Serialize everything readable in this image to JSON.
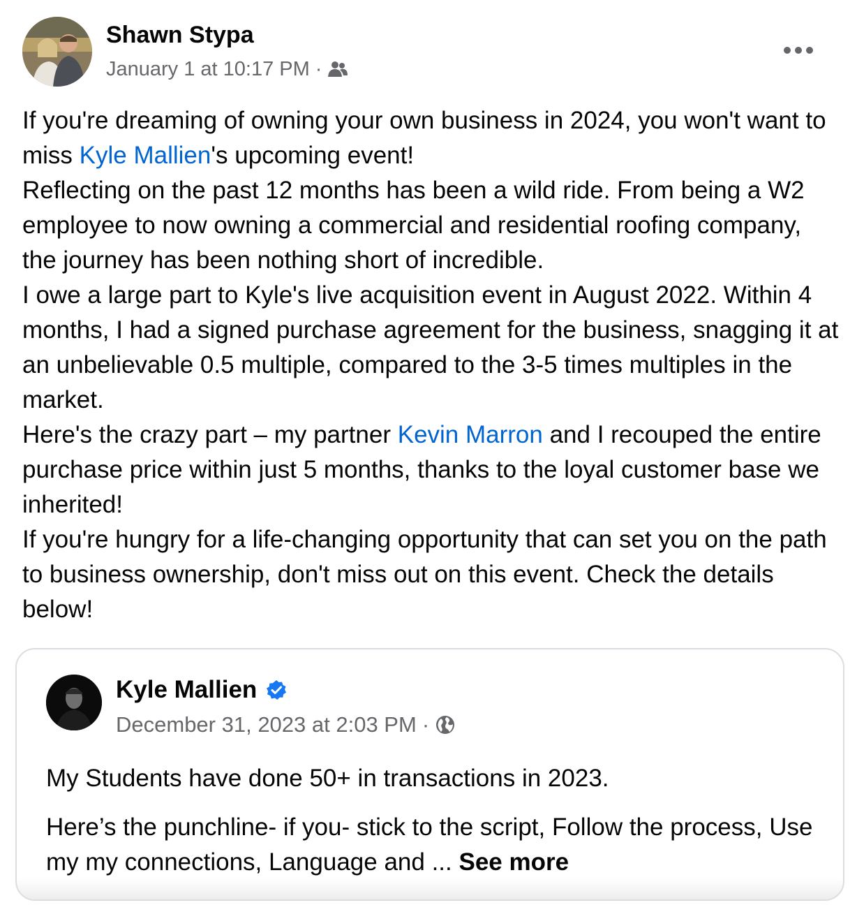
{
  "post": {
    "author": "Shawn Stypa",
    "timestamp": "January 1 at 10:17 PM",
    "separator": "·",
    "audience_icon": "friends-icon",
    "menu_icon": "more-options-icon",
    "body": {
      "p1_a": "If you're dreaming of owning your own business in 2024, you won't want to miss ",
      "p1_link": "Kyle Mallien",
      "p1_b": "'s upcoming event!",
      "p2": "Reflecting on the past 12 months has been a wild ride. From being a W2 employee to now owning a commercial and residential roofing company, the journey has been nothing short of incredible.",
      "p3": "I owe a large part to Kyle's live acquisition event in August 2022. Within 4 months, I had a signed purchase agreement for the business, snagging it at an unbelievable 0.5 multiple, compared to the 3-5 times multiples in the market.",
      "p4_a": "Here's the crazy part – my partner ",
      "p4_link": "Kevin Marron",
      "p4_b": " and I recouped the entire purchase price within just 5 months, thanks to the loyal customer base we inherited!",
      "p5": "If you're hungry for a life-changing opportunity that can set you on the path to business ownership, don't miss out on this event. Check the details below!"
    }
  },
  "shared_post": {
    "author": "Kyle Mallien",
    "verified_icon": "verified-badge-icon",
    "timestamp": "December 31, 2023 at 2:03 PM",
    "separator": "·",
    "audience_icon": "globe-icon",
    "body_p1": "My Students have done 50+ in transactions in 2023.",
    "body_p2": "Here’s the punchline- if you- stick to the script, Follow the process, Use my my connections, Language and ... ",
    "see_more": "See more"
  },
  "colors": {
    "link": "#0064d1",
    "secondary_text": "#65676b",
    "verified": "#1877f2",
    "border": "#dadde1"
  }
}
